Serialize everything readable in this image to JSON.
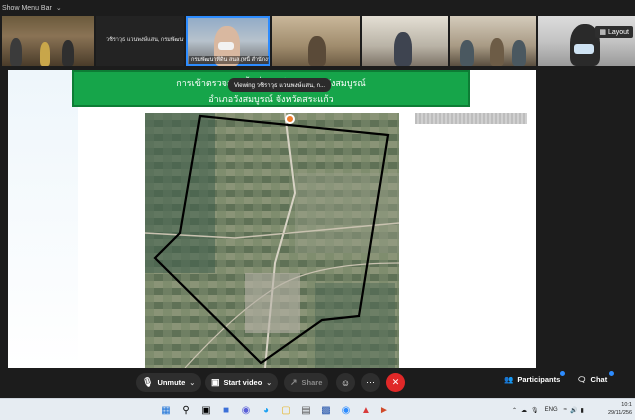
{
  "menubar": {
    "label": "Show Menu Bar"
  },
  "thumbnails": [
    {
      "name": ""
    },
    {
      "name": "วชิราวุธ แวนพงษ์แสน, กรมพัฒนาที่..."
    },
    {
      "name": "กรมพัฒนาที่ดิน สนล.(หนี้ สำนักงาน"
    },
    {
      "name": ""
    },
    {
      "name": ""
    },
    {
      "name": ""
    },
    {
      "name": ""
    }
  ],
  "layout_label": "Layout",
  "slide": {
    "title_line1": "การเข้าตรวจสอบพื้นที่แปลงใหญ่ ตำบลวังสมบูรณ์",
    "title_line2": "อำเภอวังสมบูรณ์ จังหวัดสระแก้ว",
    "viewing_tooltip": "Viewing วชิราวุธ แวนพงษ์แสน, ก..."
  },
  "controls": {
    "unmute": "Unmute",
    "start_video": "Start video",
    "share": "Share",
    "participants": "Participants",
    "chat": "Chat"
  },
  "taskbar": {
    "lang": "ENG",
    "time": "10:1",
    "date": "29/11/256"
  }
}
